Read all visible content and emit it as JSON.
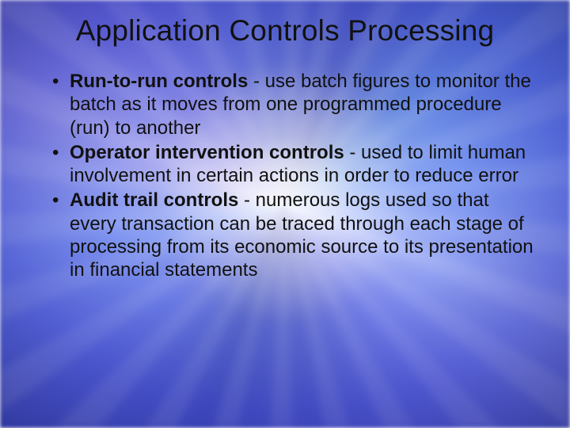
{
  "slide": {
    "title": "Application Controls Processing",
    "bullets": [
      {
        "term": "Run-to-run controls",
        "sep": " - ",
        "desc": "use batch figures to monitor the batch as it moves from one programmed procedure (run) to another"
      },
      {
        "term": "Operator intervention controls",
        "sep": "  - ",
        "desc": "used to limit human involvement in certain actions in order to reduce error"
      },
      {
        "term": "Audit trail controls",
        "sep": " - ",
        "desc": "numerous logs used so that every transaction can be traced through each stage of processing from its economic source to its presentation in financial statements"
      }
    ]
  }
}
